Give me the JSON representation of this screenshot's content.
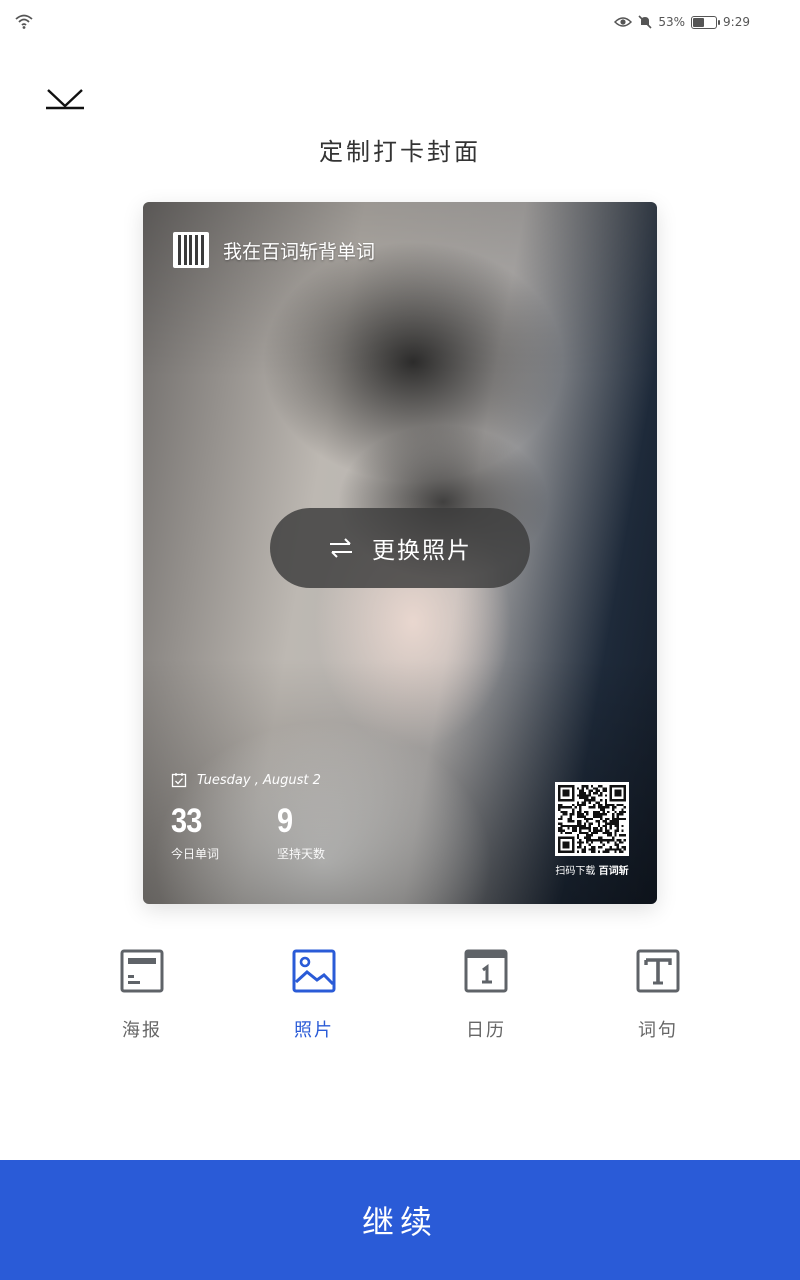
{
  "status_bar": {
    "battery_text": "53%",
    "battery_level": 0.53,
    "time": "9:29"
  },
  "page": {
    "title": "定制打卡封面"
  },
  "cover": {
    "brand_text": "我在百词斩背单词",
    "change_photo_label": "更换照片",
    "date": "Tuesday , August 2",
    "today_words_value": "33",
    "today_words_label": "今日单词",
    "streak_days_value": "9",
    "streak_days_label": "坚持天数",
    "qr_caption_prefix": "扫码下载",
    "qr_caption_brand": "百词斩"
  },
  "tabs": [
    {
      "label": "海报",
      "icon": "poster-icon",
      "active": false
    },
    {
      "label": "照片",
      "icon": "image-icon",
      "active": true
    },
    {
      "label": "日历",
      "icon": "calendar-icon",
      "active": false
    },
    {
      "label": "词句",
      "icon": "text-icon",
      "active": false
    }
  ],
  "continue_label": "继续",
  "colors": {
    "accent": "#2a5bd7",
    "tab_inactive": "#666666",
    "icon_inactive": "#5f6368"
  }
}
